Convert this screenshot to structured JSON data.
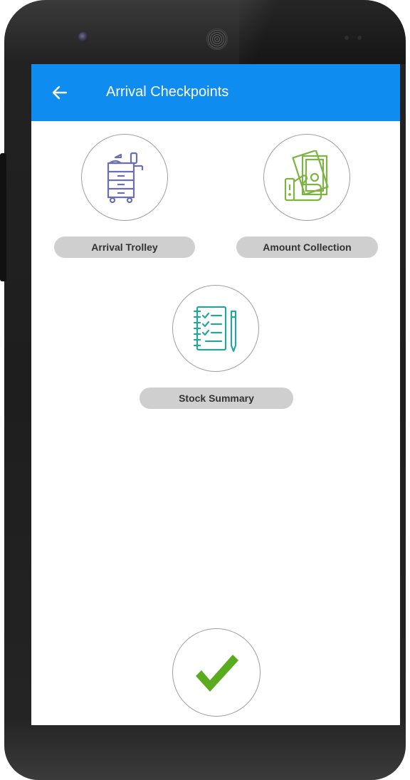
{
  "app": {
    "title": "Arrival Checkpoints"
  },
  "checkpoints": [
    {
      "label": "Arrival Trolley",
      "icon": "trolley-icon",
      "color": "#6b6fb0"
    },
    {
      "label": "Amount Collection",
      "icon": "cash-hand-icon",
      "color": "#7cb342"
    },
    {
      "label": "Stock Summary",
      "icon": "checklist-notebook-icon",
      "color": "#26a69a"
    }
  ],
  "confirm": {
    "icon": "checkmark-icon",
    "color": "#5aab1e"
  },
  "theme": {
    "appbar": "#0f8cef",
    "label_bg": "#cfcfcf"
  }
}
